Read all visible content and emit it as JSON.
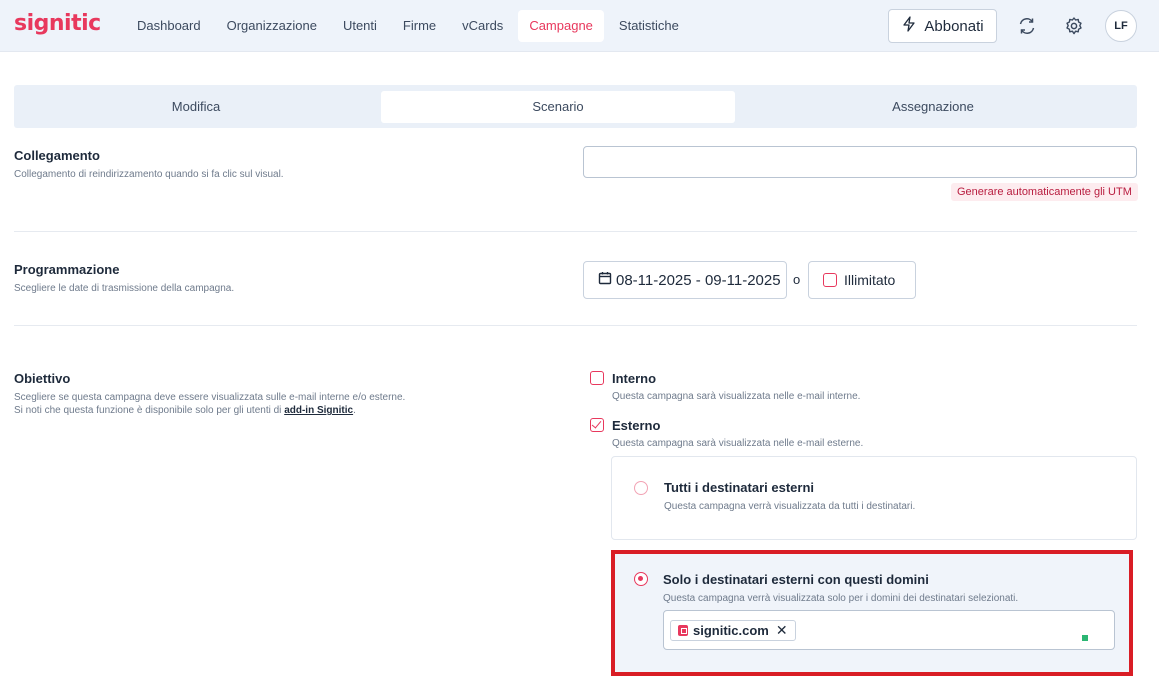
{
  "brand": {
    "logo": "signitic",
    "accent": "#e8385d"
  },
  "nav": {
    "items": [
      {
        "label": "Dashboard",
        "active": false
      },
      {
        "label": "Organizzazione",
        "active": false
      },
      {
        "label": "Utenti",
        "active": false
      },
      {
        "label": "Firme",
        "active": false
      },
      {
        "label": "vCards",
        "active": false
      },
      {
        "label": "Campagne",
        "active": true
      },
      {
        "label": "Statistiche",
        "active": false
      }
    ],
    "subscribe_label": "Abbonati",
    "avatar_initials": "LF",
    "icons": [
      "lightning-icon",
      "refresh-icon",
      "gear-icon"
    ]
  },
  "tabs": [
    {
      "label": "Modifica",
      "active": false
    },
    {
      "label": "Scenario",
      "active": true
    },
    {
      "label": "Assegnazione",
      "active": false
    }
  ],
  "link_section": {
    "title": "Collegamento",
    "description": "Collegamento di reindirizzamento quando si fa clic sul visual.",
    "input_value": "",
    "utm_button": "Generare automaticamente gli UTM"
  },
  "schedule_section": {
    "title": "Programmazione",
    "description": "Scegliere le date di trasmissione della campagna.",
    "date_range": "08-11-2025 - 09-11-2025",
    "or_text": "o",
    "unlimited_label": "Illimitato",
    "unlimited_checked": false
  },
  "objective_section": {
    "title": "Obiettivo",
    "description_line1": "Scegliere se questa campagna deve essere visualizzata sulle e-mail interne e/o esterne.",
    "description_line2_prefix": "Si noti che questa funzione è disponibile solo per gli utenti di ",
    "description_link": "add-in Signitic",
    "description_line2_suffix": ".",
    "internal": {
      "label": "Interno",
      "description": "Questa campagna sarà visualizzata nelle e-mail interne.",
      "checked": false
    },
    "external": {
      "label": "Esterno",
      "description": "Questa campagna sarà visualizzata nelle e-mail esterne.",
      "checked": true
    },
    "all_recipients": {
      "title": "Tutti i destinatari esterni",
      "description": "Questa campagna verrà visualizzata da tutti i destinatari.",
      "selected": false
    },
    "domains_only": {
      "title": "Solo i destinatari esterni con questi domini",
      "description": "Questa campagna verrà visualizzata solo per i domini dei destinatari selezionati.",
      "selected": true,
      "domains": [
        "signitic.com"
      ]
    }
  }
}
